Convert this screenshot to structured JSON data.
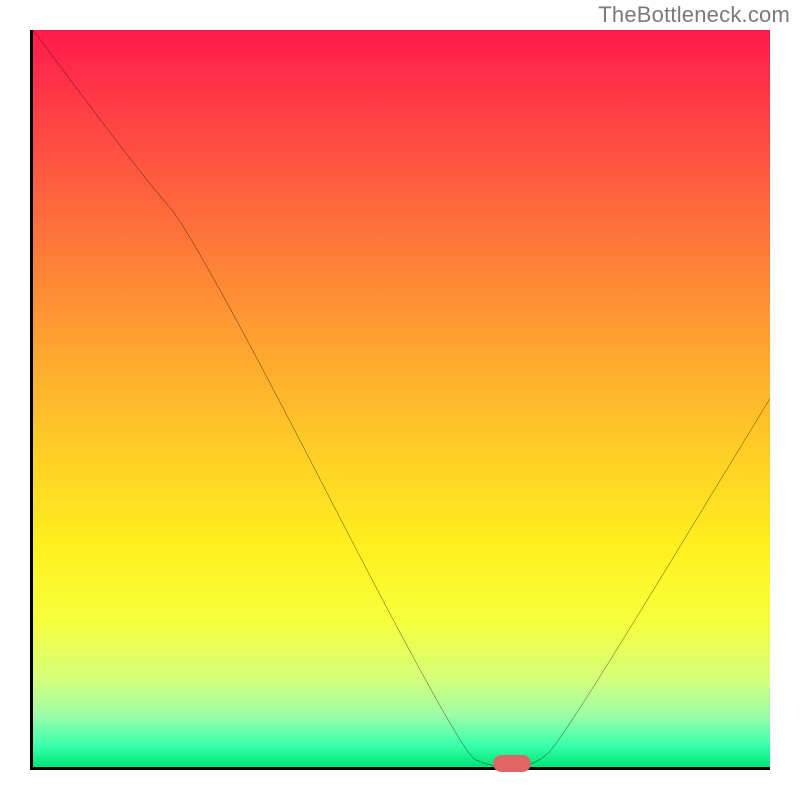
{
  "attribution": "TheBottleneck.com",
  "chart_data": {
    "type": "line",
    "title": "",
    "xlabel": "",
    "ylabel": "",
    "xlim": [
      0,
      100
    ],
    "ylim": [
      0,
      100
    ],
    "background_gradient": {
      "stops": [
        {
          "pos": 0.0,
          "color": "#ff1a4b"
        },
        {
          "pos": 0.1,
          "color": "#ff3b46"
        },
        {
          "pos": 0.25,
          "color": "#ff6b3c"
        },
        {
          "pos": 0.4,
          "color": "#ff9a32"
        },
        {
          "pos": 0.55,
          "color": "#ffc828"
        },
        {
          "pos": 0.7,
          "color": "#fff01e"
        },
        {
          "pos": 0.8,
          "color": "#f7ff3a"
        },
        {
          "pos": 0.88,
          "color": "#d6ff7a"
        },
        {
          "pos": 0.93,
          "color": "#9cffa8"
        },
        {
          "pos": 0.97,
          "color": "#3affad"
        },
        {
          "pos": 1.0,
          "color": "#00e676"
        }
      ]
    },
    "series": [
      {
        "name": "bottleneck-curve",
        "color": "#000000",
        "x": [
          0,
          15,
          22,
          58,
          62,
          68,
          72,
          100
        ],
        "y": [
          100,
          80,
          72,
          2,
          0,
          0,
          4,
          50
        ]
      }
    ],
    "marker": {
      "name": "optimal-point",
      "color": "#e06666",
      "x": 65,
      "y": 0,
      "shape": "rounded-bar"
    }
  }
}
